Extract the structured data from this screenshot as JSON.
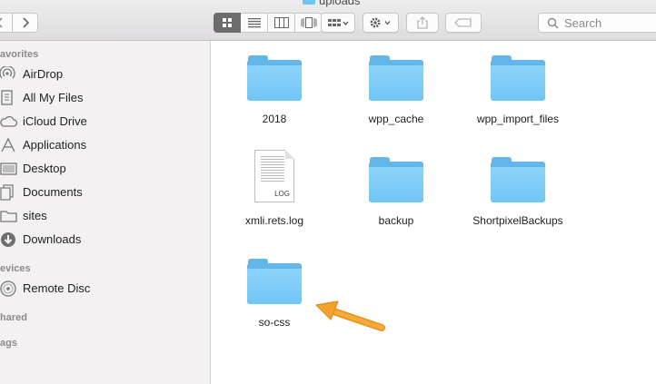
{
  "window": {
    "title": "uploads"
  },
  "toolbar": {
    "search_placeholder": "Search",
    "view_modes": [
      "icon-view",
      "list-view",
      "column-view",
      "cover-flow-view"
    ],
    "active_view": "icon-view"
  },
  "sidebar": {
    "sections": [
      {
        "title": "avorites",
        "items": [
          {
            "label": "AirDrop",
            "icon": "airdrop-icon"
          },
          {
            "label": "All My Files",
            "icon": "all-files-icon"
          },
          {
            "label": "iCloud Drive",
            "icon": "cloud-icon"
          },
          {
            "label": "Applications",
            "icon": "applications-icon"
          },
          {
            "label": "Desktop",
            "icon": "desktop-icon"
          },
          {
            "label": "Documents",
            "icon": "documents-icon"
          },
          {
            "label": "sites",
            "icon": "folder-icon"
          },
          {
            "label": "Downloads",
            "icon": "downloads-icon"
          }
        ]
      },
      {
        "title": "evices",
        "items": [
          {
            "label": "Remote Disc",
            "icon": "disc-icon"
          }
        ]
      },
      {
        "title": "hared",
        "items": []
      },
      {
        "title": "ags",
        "items": []
      }
    ]
  },
  "files": [
    {
      "name": "2018",
      "kind": "folder"
    },
    {
      "name": "wpp_cache",
      "kind": "folder"
    },
    {
      "name": "wpp_import_files",
      "kind": "folder"
    },
    {
      "name": "xmli.rets.log",
      "kind": "log",
      "badge": "LOG"
    },
    {
      "name": "backup",
      "kind": "folder"
    },
    {
      "name": "ShortpixelBackups",
      "kind": "folder"
    },
    {
      "name": "so-css",
      "kind": "folder"
    }
  ],
  "colors": {
    "folder_front": "#71c5f5",
    "folder_back": "#62b6ea",
    "arrow": "#f4a02b",
    "sidebar_bg": "#f4f1f2"
  }
}
